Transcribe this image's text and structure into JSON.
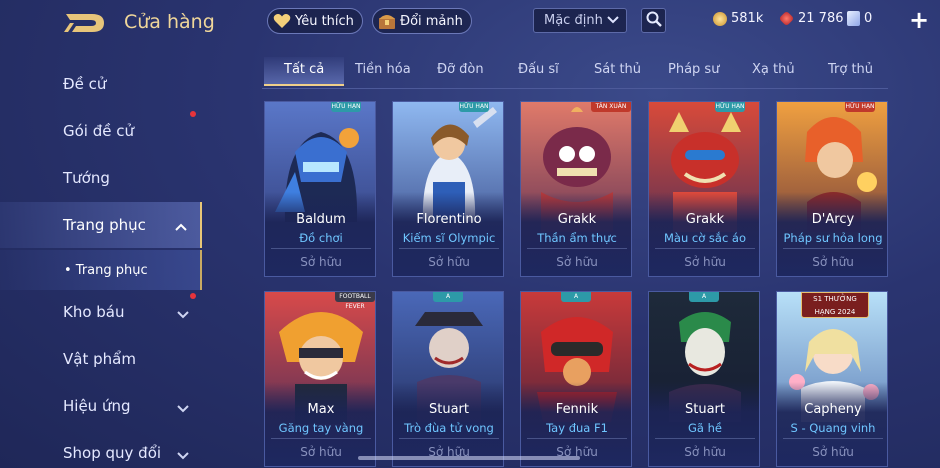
{
  "header": {
    "title": "Cửa hàng",
    "favorites_label": "Yêu thích",
    "exchange_label": "Đổi mảnh",
    "sort_label": "Mặc định",
    "gold": "581k",
    "diamonds": "21 786",
    "vouchers": "0"
  },
  "sidebar": {
    "items": [
      {
        "label": "Đề cử"
      },
      {
        "label": "Gói đề cử"
      },
      {
        "label": "Tướng"
      },
      {
        "label": "Trang phục"
      },
      {
        "label": "Kho báu"
      },
      {
        "label": "Vật phẩm"
      },
      {
        "label": "Hiệu ứng"
      },
      {
        "label": "Shop quy đổi"
      }
    ],
    "sub_item": "• Trang phục"
  },
  "tabs": [
    "Tất cả",
    "Tiền hóa",
    "Đỡ đòn",
    "Đấu sĩ",
    "Sát thủ",
    "Pháp sư",
    "Xạ thủ",
    "Trợ thủ"
  ],
  "cards": [
    {
      "hero": "Baldum",
      "skin": "Đồ chơi",
      "status": "Sở hữu",
      "badge": "HỮU HẠN"
    },
    {
      "hero": "Florentino",
      "skin": "Kiếm sĩ Olympic",
      "status": "Sở hữu",
      "badge": "HỮU HẠN"
    },
    {
      "hero": "Grakk",
      "skin": "Thần ẩm thực",
      "status": "Sở hữu",
      "badge": "TÂN XUÂN"
    },
    {
      "hero": "Grakk",
      "skin": "Màu cờ sắc áo",
      "status": "Sở hữu",
      "badge": "HỮU HẠN"
    },
    {
      "hero": "D'Arcy",
      "skin": "Pháp sư hỏa long",
      "status": "Sở hữu",
      "badge": "HỮU HẠN"
    },
    {
      "hero": "Max",
      "skin": "Găng tay vàng",
      "status": "Sở hữu",
      "badge": "FOOTBALL FEVER"
    },
    {
      "hero": "Stuart",
      "skin": "Trò đùa tử vong",
      "status": "Sở hữu",
      "badge": "A"
    },
    {
      "hero": "Fennik",
      "skin": "Tay đua F1",
      "status": "Sở hữu",
      "badge": "A"
    },
    {
      "hero": "Stuart",
      "skin": "Gã hề",
      "status": "Sở hữu",
      "badge": "A"
    },
    {
      "hero": "Capheny",
      "skin": "S - Quang vinh",
      "status": "Sở hữu",
      "badge": "S1 THƯỞNG HẠNG 2024"
    }
  ],
  "colors": {
    "accent_gold": "#f0d79a",
    "skin_blue": "#6fc6ff",
    "red_dot": "#e6343b"
  }
}
